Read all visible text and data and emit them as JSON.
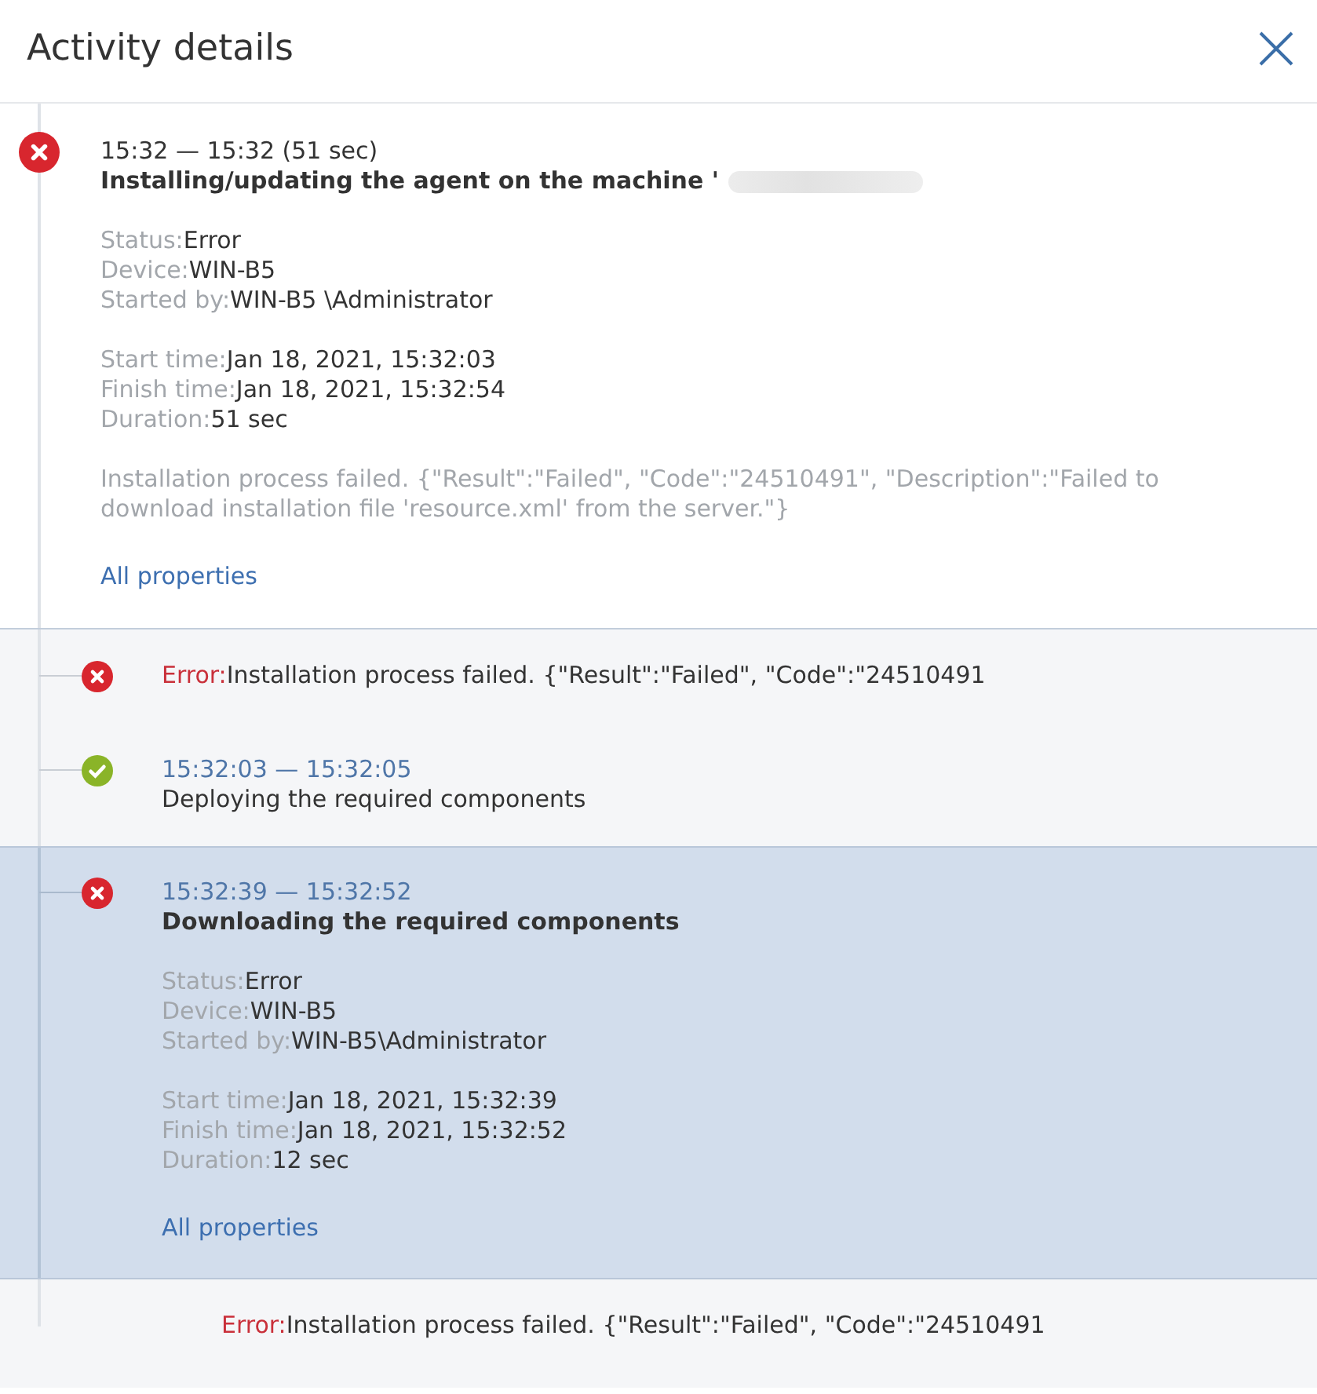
{
  "header": {
    "title": "Activity details"
  },
  "activity": {
    "failed": true,
    "time_range": "15:32 — 15:32 (51 sec)",
    "title": "Installing/updating the agent on the machine '",
    "redacted": true,
    "property_groups": [
      [
        {
          "label": "Status:",
          "value": "Error"
        },
        {
          "label": "Device:",
          "value": "WIN-B5"
        },
        {
          "label": "Started by:",
          "value": "WIN-B5 \\Administrator"
        }
      ],
      [
        {
          "label": "Start time:",
          "value": "Jan 18, 2021, 15:32:03"
        },
        {
          "label": "Finish time:",
          "value": "Jan 18, 2021, 15:32:54"
        },
        {
          "label": "Duration:",
          "value": "51 sec"
        }
      ]
    ],
    "description": "Installation process failed. {\"Result\":\"Failed\", \"Code\":\"24510491\", \"Description\":\"Failed to download installation file 'resource.xml' from the server.\"}",
    "link": "All properties"
  },
  "steps": [
    {
      "kind": "message",
      "failed": true,
      "selected": false,
      "label": "Error:",
      "text": "Installation process failed. {\"Result\":\"Failed\", \"Code\":\"24510491"
    },
    {
      "kind": "activity",
      "failed": false,
      "selected": false,
      "expanded": false,
      "time_range": "15:32:03 — 15:32:05",
      "title": "Deploying the required components"
    },
    {
      "kind": "activity",
      "failed": true,
      "selected": true,
      "expanded": true,
      "time_range": "15:32:39 — 15:32:52",
      "title": "Downloading the required components",
      "property_groups": [
        [
          {
            "label": "Status:",
            "value": "Error"
          },
          {
            "label": "Device:",
            "value": "WIN-B5"
          },
          {
            "label": "Started by:",
            "value": "WIN-B5\\Administrator"
          }
        ],
        [
          {
            "label": "Start time:",
            "value": "Jan 18, 2021, 15:32:39"
          },
          {
            "label": "Finish time:",
            "value": "Jan 18, 2021, 15:32:52"
          },
          {
            "label": "Duration:",
            "value": "12 sec"
          }
        ]
      ],
      "link": "All properties"
    },
    {
      "kind": "note",
      "selected": false,
      "label": "Error:",
      "text": "Installation process failed. {\"Result\":\"Failed\", \"Code\":\"24510491"
    }
  ]
}
